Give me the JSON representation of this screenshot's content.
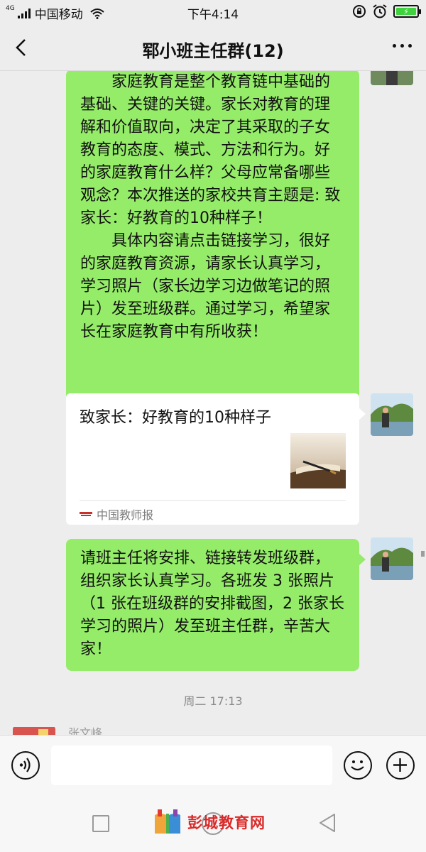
{
  "status_bar": {
    "network_type": "4G",
    "carrier": "中国移动",
    "time": "下午4:14",
    "battery_color": "#3fd23f"
  },
  "header": {
    "title": "郓小班主任群(12)"
  },
  "messages": {
    "msg1": {
      "paragraph1": "家庭教育是整个教育链中基础的基础、关键的关键。家长对教育的理解和价值取向，决定了其采取的子女教育的态度、模式、方法和行为。好的家庭教育什么样？父母应常备哪些观念？本次推送的家校共育主题是: 致家长：好教育的10种样子！",
      "paragraph2": "具体内容请点击链接学习，很好的家庭教育资源，请家长认真学习，学习照片（家长边学习边做笔记的照片）发至班级群。通过学习，希望家长在家庭教育中有所收获！"
    },
    "link_card": {
      "title": "致家长：好教育的10种样子",
      "source": "中国教师报"
    },
    "msg3": {
      "text": "请班主任将安排、链接转发班级群，组织家长认真学习。各班发 3 张照片（1 张在班级群的安排截图，2 张家长学习的照片）发至班主任群，辛苦大家！"
    },
    "timestamp": "周二 17:13",
    "next_sender": "张文峰"
  },
  "input_bar": {
    "placeholder": ""
  },
  "watermark": {
    "text": "彭城教育网"
  },
  "colors": {
    "bubble_green": "#95ec69",
    "background": "#ededed"
  }
}
